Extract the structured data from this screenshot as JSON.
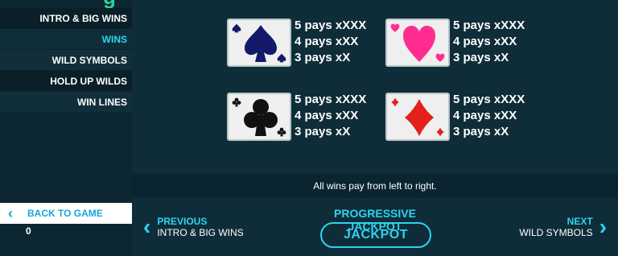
{
  "sidebar": {
    "items": [
      {
        "label": "INTRO & BIG WINS"
      },
      {
        "label": "WINS"
      },
      {
        "label": "WILD SYMBOLS"
      },
      {
        "label": "HOLD UP WILDS"
      },
      {
        "label": "WIN LINES"
      }
    ],
    "active_index": 1,
    "back_label": "BACK TO GAME",
    "balance": "0"
  },
  "paytable": [
    {
      "symbol": "spade-icon",
      "color": "#131a6a",
      "lines": [
        "5 pays xXXX",
        "4 pays xXX",
        "3 pays xX"
      ]
    },
    {
      "symbol": "heart-icon",
      "color": "#ff2d8f",
      "lines": [
        "5 pays xXXX",
        "4 pays xXX",
        "3 pays xX"
      ]
    },
    {
      "symbol": "club-icon",
      "color": "#111111",
      "lines": [
        "5 pays xXXX",
        "4 pays xXX",
        "3 pays xX"
      ]
    },
    {
      "symbol": "diamond-icon",
      "color": "#e3201b",
      "lines": [
        "5 pays xXXX",
        "4 pays xXX",
        "3 pays xX"
      ]
    }
  ],
  "note": "All wins pay from left to right.",
  "footer": {
    "prev_label": "PREVIOUS",
    "prev_sub": "INTRO & BIG WINS",
    "jackpot_title": "PROGRESSIVE JACKPOT",
    "jackpot_button": "JACKPOT",
    "next_label": "NEXT",
    "next_sub": "WILD SYMBOLS"
  },
  "colors": {
    "accent": "#2ed3ee",
    "background": "#0e2d39"
  }
}
